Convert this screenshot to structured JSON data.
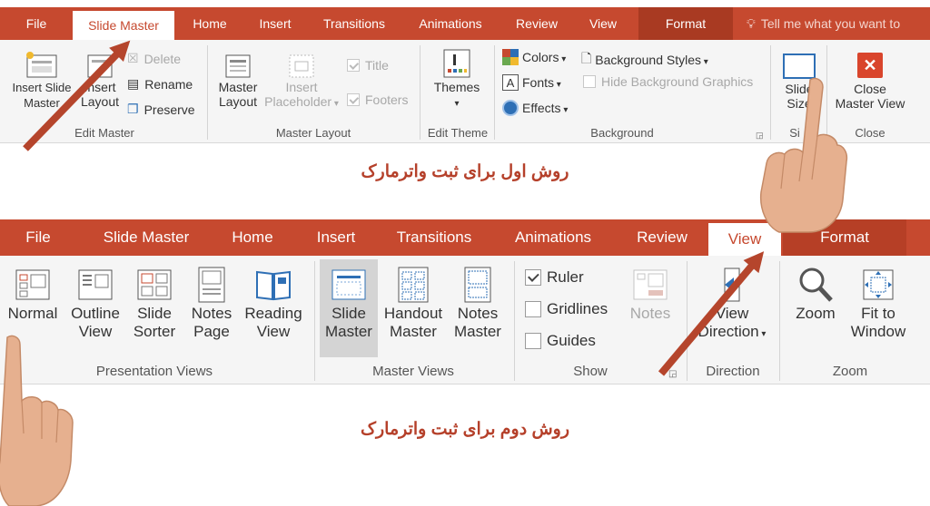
{
  "ribbon1": {
    "tabs": [
      "File",
      "Slide Master",
      "Home",
      "Insert",
      "Transitions",
      "Animations",
      "Review",
      "View",
      "Format"
    ],
    "tell_me": "Tell me what you want to",
    "groups": {
      "edit_master": {
        "label": "Edit Master",
        "insert_slide_master": "Insert Slide\nMaster",
        "insert_layout": "Insert\nLayout",
        "delete": "Delete",
        "rename": "Rename",
        "preserve": "Preserve"
      },
      "master_layout": {
        "label": "Master Layout",
        "master_layout_btn": "Master\nLayout",
        "insert_placeholder": "Insert\nPlaceholder",
        "title": "Title",
        "footers": "Footers"
      },
      "edit_theme": {
        "label": "Edit Theme",
        "themes": "Themes"
      },
      "background": {
        "label": "Background",
        "colors": "Colors",
        "fonts": "Fonts",
        "effects": "Effects",
        "background_styles": "Background Styles",
        "hide_background": "Hide Background Graphics"
      },
      "size": {
        "label": "Si",
        "slide_size": "Slide\nSize"
      },
      "close": {
        "label": "Close",
        "close_master_view": "Close\nMaster View"
      }
    }
  },
  "caption1": "روش اول برای ثبت واترمارک",
  "ribbon2": {
    "tabs": [
      "File",
      "Slide Master",
      "Home",
      "Insert",
      "Transitions",
      "Animations",
      "Review",
      "View",
      "Format"
    ],
    "groups": {
      "presentation_views": {
        "label": "Presentation Views",
        "normal": "Normal",
        "outline_view": "Outline\nView",
        "slide_sorter": "Slide\nSorter",
        "notes_page": "Notes\nPage",
        "reading_view": "Reading\nView"
      },
      "master_views": {
        "label": "Master Views",
        "slide_master": "Slide\nMaster",
        "handout_master": "Handout\nMaster",
        "notes_master": "Notes\nMaster"
      },
      "show": {
        "label": "Show",
        "ruler": "Ruler",
        "gridlines": "Gridlines",
        "guides": "Guides",
        "notes": "Notes"
      },
      "direction": {
        "label": "Direction",
        "view_direction": "View\nDirection"
      },
      "zoom": {
        "label": "Zoom",
        "zoom_btn": "Zoom",
        "fit_to_window": "Fit to\nWindow"
      }
    }
  },
  "caption2": "روش دوم برای ثبت واترمارک",
  "colors": {
    "accent": "#c6492f",
    "arrow": "#b5452c",
    "caption": "#b5402a",
    "skin": "#e6b08f"
  }
}
